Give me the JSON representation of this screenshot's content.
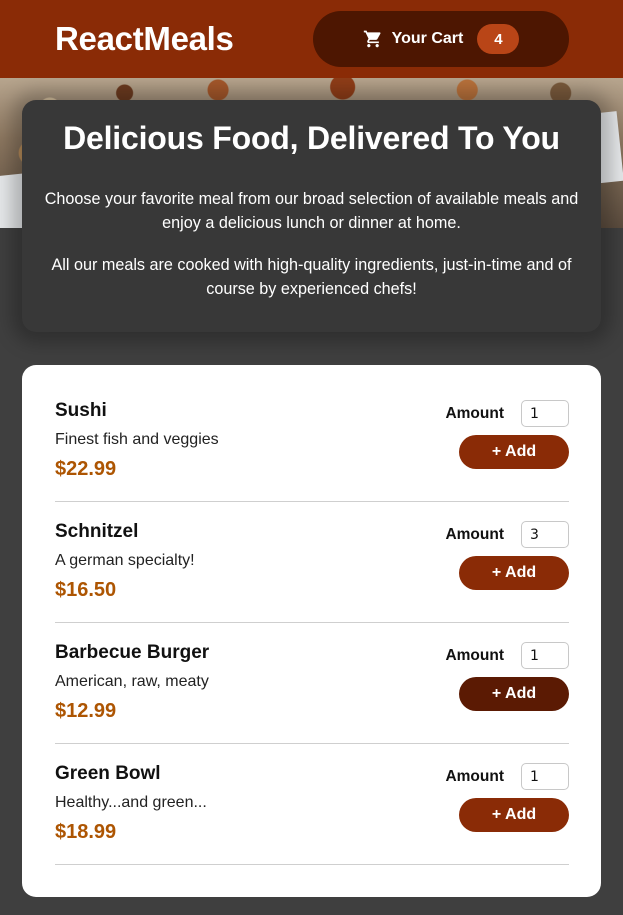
{
  "header": {
    "logo": "ReactMeals",
    "cart_label": "Your Cart",
    "cart_count": "4",
    "cart_icon": "shopping-cart-icon"
  },
  "summary": {
    "title": "Delicious Food, Delivered To You",
    "paragraph1": "Choose your favorite meal from our broad selection of available meals and enjoy a delicious lunch or dinner at home.",
    "paragraph2": "All our meals are cooked with high-quality ingredients, just-in-time and of course by experienced chefs!"
  },
  "meals": [
    {
      "name": "Sushi",
      "description": "Finest fish and veggies",
      "price": "$22.99",
      "amount_label": "Amount",
      "amount": "1",
      "add_label": "+ Add"
    },
    {
      "name": "Schnitzel",
      "description": "A german specialty!",
      "price": "$16.50",
      "amount_label": "Amount",
      "amount": "3",
      "add_label": "+ Add"
    },
    {
      "name": "Barbecue Burger",
      "description": "American, raw, meaty",
      "price": "$12.99",
      "amount_label": "Amount",
      "amount": "1",
      "add_label": "+ Add"
    },
    {
      "name": "Green Bowl",
      "description": "Healthy...and green...",
      "price": "$18.99",
      "amount_label": "Amount",
      "amount": "1",
      "add_label": "+ Add"
    }
  ],
  "colors": {
    "header": "#8a2b06",
    "cart_button": "#4d1601",
    "badge": "#b94517",
    "price": "#ad5502",
    "background": "#3f3f3f"
  }
}
